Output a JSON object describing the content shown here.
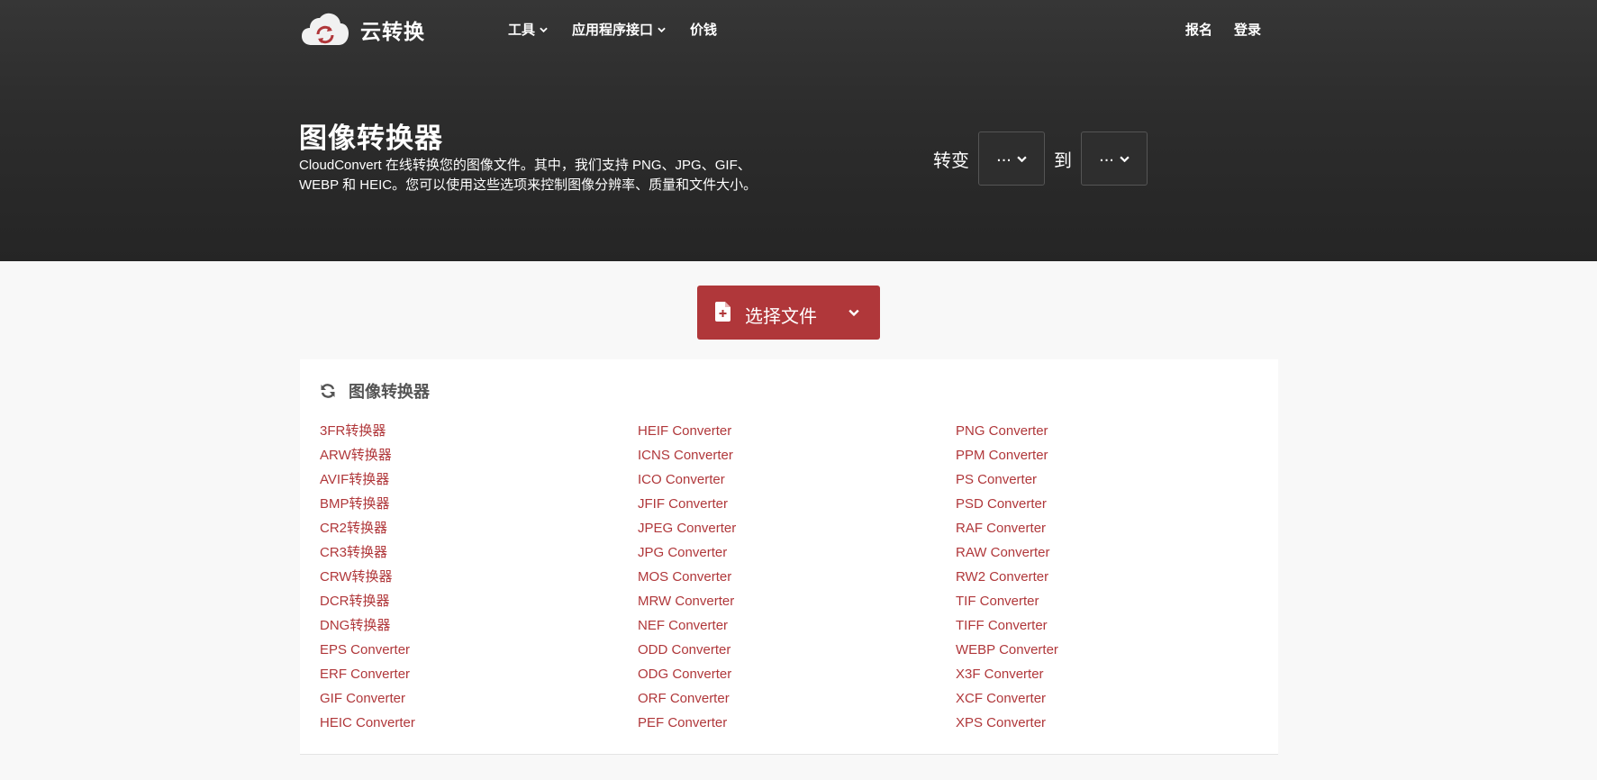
{
  "brand": {
    "name": "云转换",
    "logo_icon": "cloud-sync-icon",
    "accent_color": "#b0373a"
  },
  "nav": {
    "items": [
      {
        "label": "工具",
        "has_dropdown": true
      },
      {
        "label": "应用程序接口",
        "has_dropdown": true
      },
      {
        "label": "价钱",
        "has_dropdown": false
      }
    ],
    "right": {
      "signup": "报名",
      "login": "登录"
    }
  },
  "hero": {
    "title": "图像转换器",
    "description_line1": "CloudConvert 在线转换您的图像文件。其中，我们支持 PNG、JPG、GIF、",
    "description_line2": "WEBP 和 HEIC。您可以使用这些选项来控制图像分辨率、质量和文件大小。",
    "convert_label": "转变",
    "to_label": "到",
    "from_value": "...",
    "to_value": "..."
  },
  "select_file": {
    "label": "选择文件",
    "icon": "file-plus-icon"
  },
  "panel": {
    "title": "图像转换器",
    "icon": "refresh-icon",
    "columns": [
      [
        "3FR转换器",
        "ARW转换器",
        "AVIF转换器",
        "BMP转换器",
        "CR2转换器",
        "CR3转换器",
        "CRW转换器",
        "DCR转换器",
        "DNG转换器",
        "EPS Converter",
        "ERF Converter",
        "GIF Converter",
        "HEIC Converter"
      ],
      [
        "HEIF Converter",
        "ICNS Converter",
        "ICO Converter",
        "JFIF Converter",
        "JPEG Converter",
        "JPG Converter",
        "MOS Converter",
        "MRW Converter",
        "NEF Converter",
        "ODD Converter",
        "ODG Converter",
        "ORF Converter",
        "PEF Converter"
      ],
      [
        "PNG Converter",
        "PPM Converter",
        "PS Converter",
        "PSD Converter",
        "RAF Converter",
        "RAW Converter",
        "RW2 Converter",
        "TIF Converter",
        "TIFF Converter",
        "WEBP Converter",
        "X3F Converter",
        "XCF Converter",
        "XPS Converter"
      ]
    ]
  }
}
